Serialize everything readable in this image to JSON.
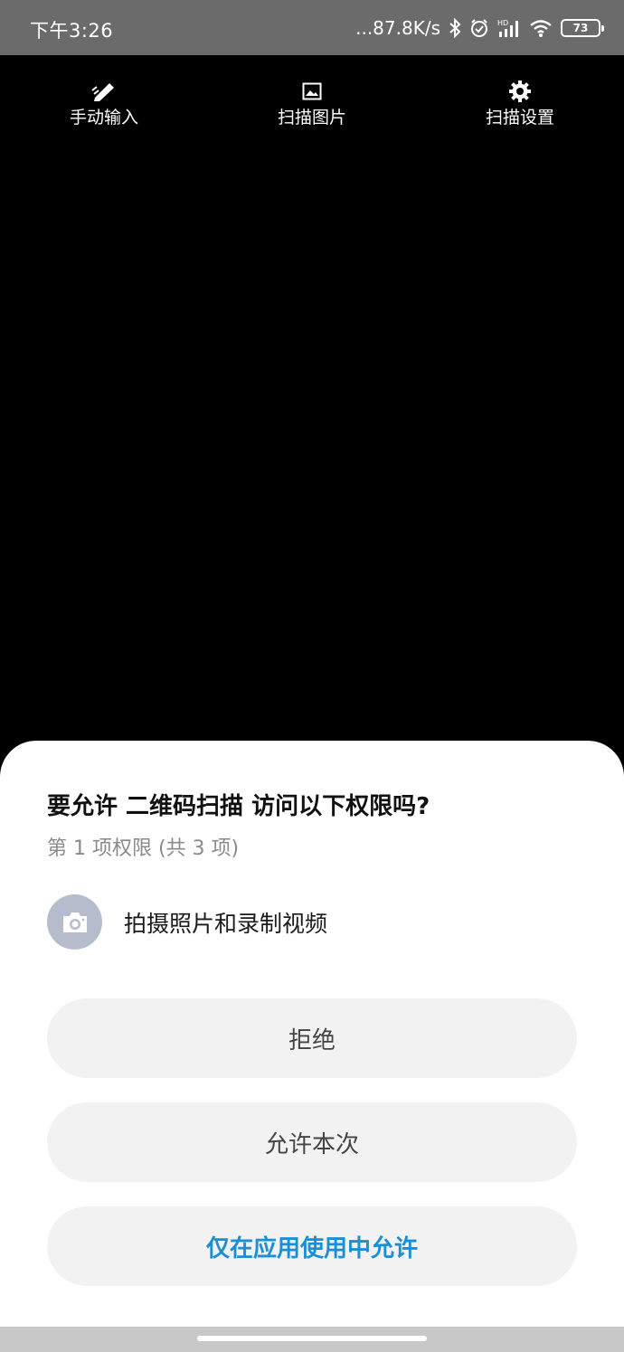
{
  "status_bar": {
    "time": "下午3:26",
    "net_speed": "...87.8K/s",
    "battery": "73",
    "icons": [
      "bluetooth-icon",
      "alarm-icon",
      "hd-signal-icon",
      "wifi-icon",
      "battery-icon"
    ]
  },
  "toolbar": {
    "manual_input": "手动输入",
    "scan_image": "扫描图片",
    "scan_settings": "扫描设置"
  },
  "dialog": {
    "title": "要允许 二维码扫描 访问以下权限吗?",
    "subtitle": "第 1 项权限 (共 3 项)",
    "permission_label": "拍摄照片和录制视频",
    "permission_icon": "camera-icon",
    "deny_label": "拒绝",
    "allow_once_label": "允许本次",
    "allow_while_using_label": "仅在应用使用中允许"
  },
  "colors": {
    "accent": "#1a8fd8",
    "permission_icon_bg": "#b5bccc",
    "button_bg": "#f2f2f2"
  }
}
